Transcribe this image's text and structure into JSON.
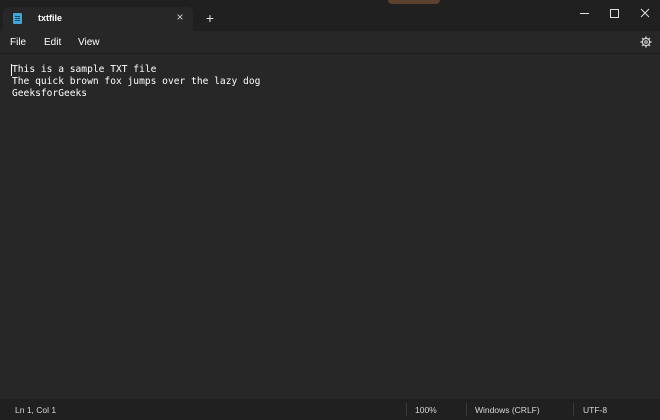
{
  "window": {
    "tab_title": "txtfile",
    "tab_close_glyph": "×",
    "new_tab_glyph": "+",
    "icons": {
      "tab": "notepad-icon",
      "minimize": "minimize-icon",
      "maximize": "maximize-icon",
      "close": "close-icon",
      "settings": "gear-icon"
    }
  },
  "menu": {
    "file": "File",
    "edit": "Edit",
    "view": "View"
  },
  "editor": {
    "lines": [
      "This is a sample TXT file",
      "The quick brown fox jumps over the lazy dog",
      "GeeksforGeeks"
    ]
  },
  "status": {
    "position": "Ln 1, Col 1",
    "zoom": "100%",
    "line_ending": "Windows (CRLF)",
    "encoding": "UTF-8"
  },
  "colors": {
    "background": "#272727",
    "titlebar": "#202020",
    "text": "#ffffff",
    "tab_icon": "#3ea7d8"
  }
}
